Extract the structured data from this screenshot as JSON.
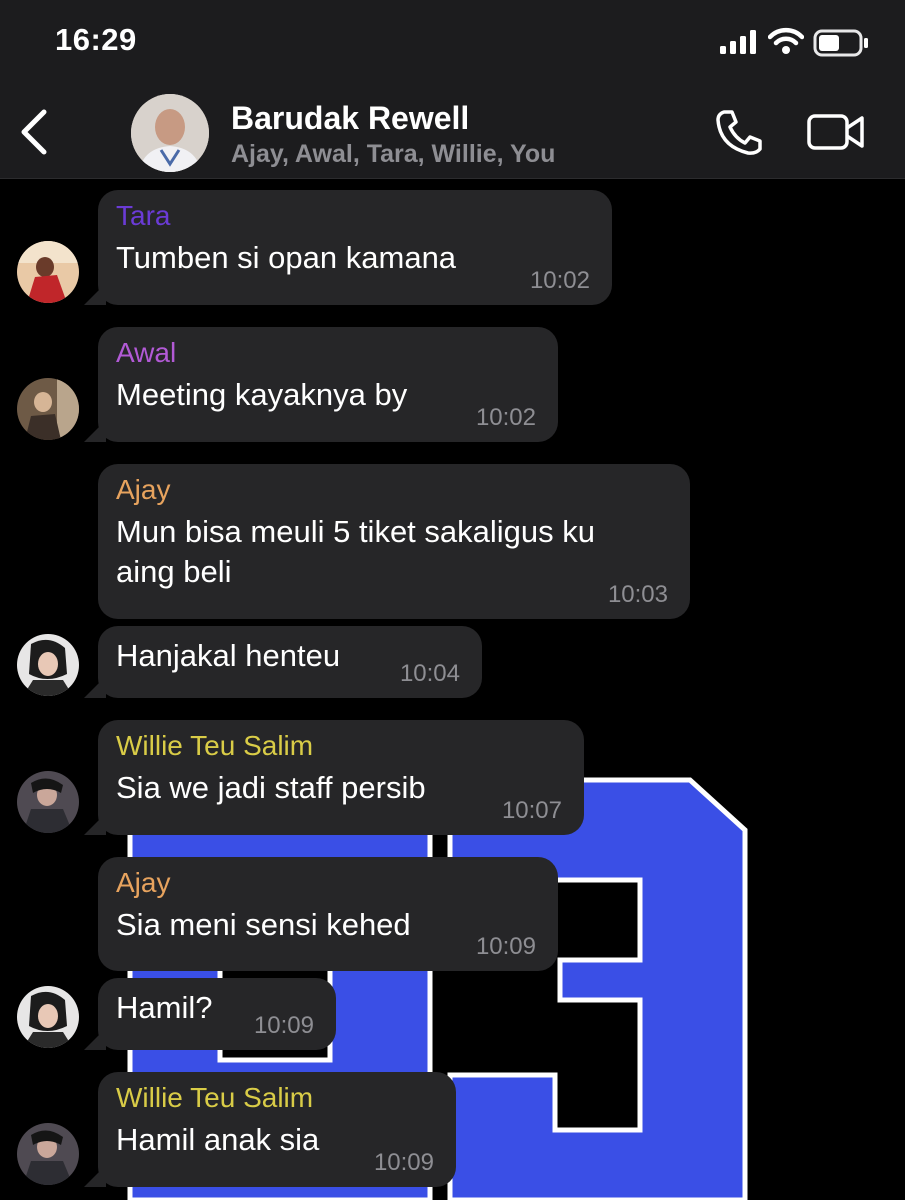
{
  "status_bar": {
    "time": "16:29"
  },
  "header": {
    "title": "Barudak Rewell",
    "members": "Ajay, Awal, Tara, Willie, You"
  },
  "icons": {
    "back": "chevron-left-icon",
    "call": "phone-icon",
    "video": "video-camera-icon"
  },
  "colors": {
    "tara": "#6b3bd6",
    "awal": "#b25ad6",
    "ajay": "#e7a35e",
    "willie": "#d9cc47",
    "bubble": "#262628",
    "jersey_blue": "#3a4fe6"
  },
  "messages": [
    {
      "sender": "Tara",
      "text": "Tumben si opan kamana",
      "time": "10:02"
    },
    {
      "sender": "Awal",
      "text": "Meeting kayaknya by",
      "time": "10:02"
    },
    {
      "sender": "Ajay",
      "text": "Mun bisa meuli 5 tiket sakaligus ku aing beli",
      "time": "10:03"
    },
    {
      "sender": "",
      "text": "Hanjakal henteu",
      "time": "10:04"
    },
    {
      "sender": "Willie Teu Salim",
      "text": "Sia we jadi staff persib",
      "time": "10:07"
    },
    {
      "sender": "Ajay",
      "text": "Sia meni sensi kehed",
      "time": "10:09"
    },
    {
      "sender": "",
      "text": "Hamil?",
      "time": "10:09"
    },
    {
      "sender": "Willie Teu Salim",
      "text": "Hamil anak sia",
      "time": "10:09"
    }
  ]
}
